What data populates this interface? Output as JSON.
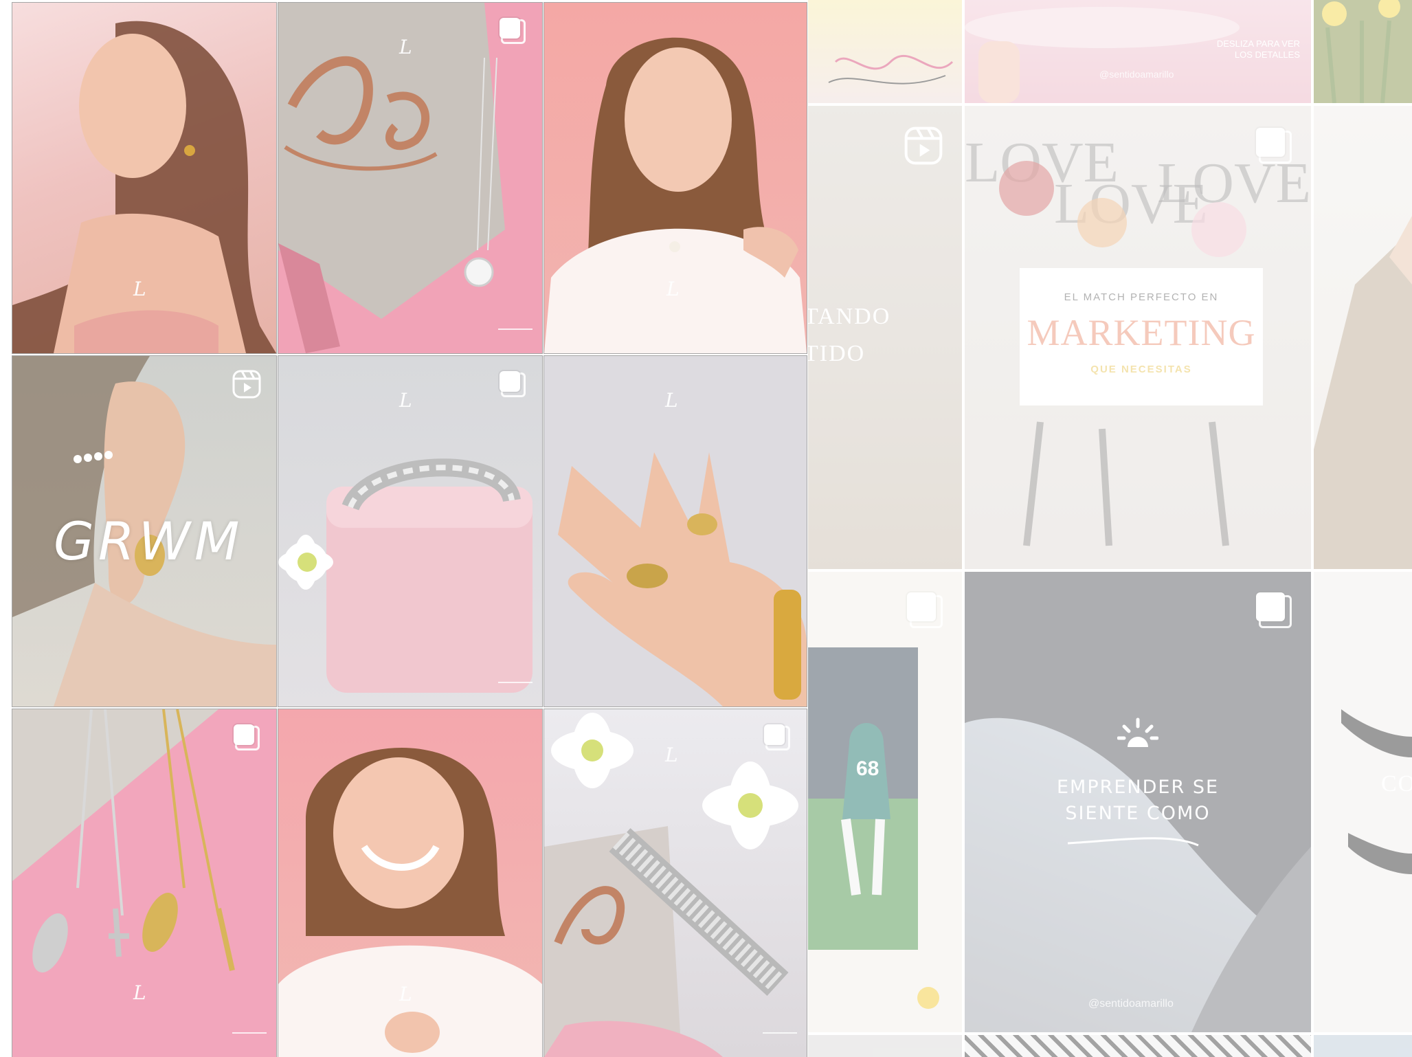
{
  "feed": {
    "brand_mark": "L",
    "grwm_title": "GRWM",
    "marketing_card": {
      "top_line": "EL MATCH PERFECTO EN",
      "headline": "MARKETING",
      "sub_line": "QUE NECESITAS"
    },
    "emprender_text_1": "EMPRENDER SE",
    "emprender_text_2": "SIENTE COMO",
    "handle_1": "@sentidoamarillo",
    "handle_2": "@sentidoamarillo",
    "swipe_hint_1": "DESLIZA PARA VER",
    "swipe_hint_2": "LOS DETALLES",
    "partial_text_1": "TANDO",
    "partial_text_2": "TIDO",
    "partial_text_3": "CO",
    "jersey_number": "68"
  },
  "colors": {
    "pink": "#f2a9b8",
    "blush": "#f9c9c4",
    "grey_bg": "#dcdde0",
    "accent_orange": "#e88a6a",
    "accent_yellow": "#e6c24c"
  },
  "icons": {
    "carousel": "carousel-icon",
    "reel": "reel-icon"
  }
}
